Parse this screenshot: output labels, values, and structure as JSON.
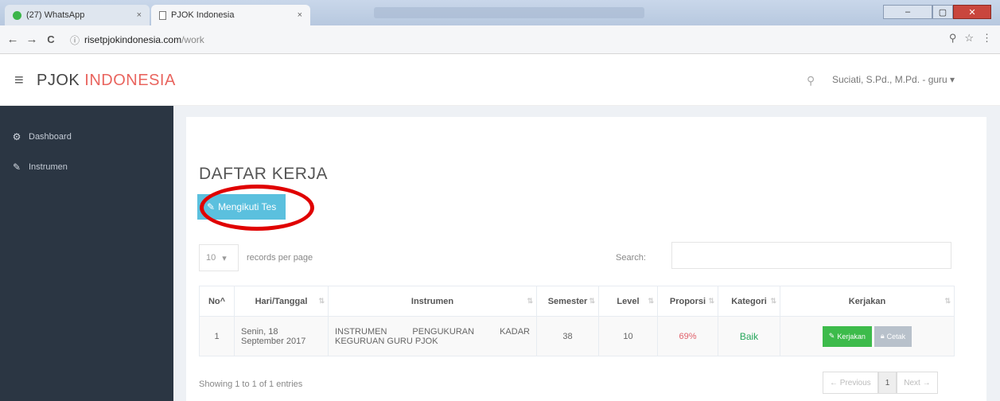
{
  "browser": {
    "tabs": [
      {
        "title": "(27) WhatsApp",
        "close": "×"
      },
      {
        "title": "PJOK Indonesia",
        "close": "×"
      }
    ],
    "url_host": "risetpjokindonesia.com",
    "url_path": "/work",
    "nav": {
      "back": "←",
      "forward": "→",
      "reload": "C",
      "info": "ⓘ"
    },
    "addr_icons": {
      "zoom": "⚲",
      "star": "☆",
      "menu": "⋮"
    }
  },
  "header": {
    "menu_icon": "≡",
    "brand_part1": "PJOK ",
    "brand_part2": "INDONESIA",
    "search_icon": "⚲",
    "user": "Suciati, S.Pd., M.Pd. - guru ▾"
  },
  "sidebar": {
    "items": [
      {
        "icon": "⚙",
        "label": "Dashboard"
      },
      {
        "icon": "✎",
        "label": "Instrumen"
      }
    ]
  },
  "main": {
    "title": "DAFTAR KERJA",
    "follow_button": "Mengikuti Tes",
    "length_value": "10",
    "length_label": "records per page",
    "search_label": "Search:",
    "table": {
      "headers": [
        "No",
        "Hari/Tanggal",
        "Instrumen",
        "Semester",
        "Level",
        "Proporsi",
        "Kategori",
        "Kerjakan"
      ],
      "rows": [
        {
          "no": "1",
          "date": "Senin, 18 September 2017",
          "instrumen": "INSTRUMEN PENGUKURAN KADAR KEGURUAN GURU PJOK",
          "semester": "38",
          "level": "10",
          "proporsi": "69%",
          "kategori": "Baik",
          "btn_kerjakan": "Kerjakan",
          "btn_cetak": "Cetak"
        }
      ]
    },
    "info": "Showing 1 to 1 of 1 entries",
    "pager": {
      "prev": "← Previous",
      "page": "1",
      "next": "Next →"
    }
  },
  "colors": {
    "brand_accent": "#e9655f",
    "sidebar": "#2b3643",
    "info_button": "#5bc0de",
    "success": "#3dbb4b",
    "highlight": "#e00000"
  }
}
